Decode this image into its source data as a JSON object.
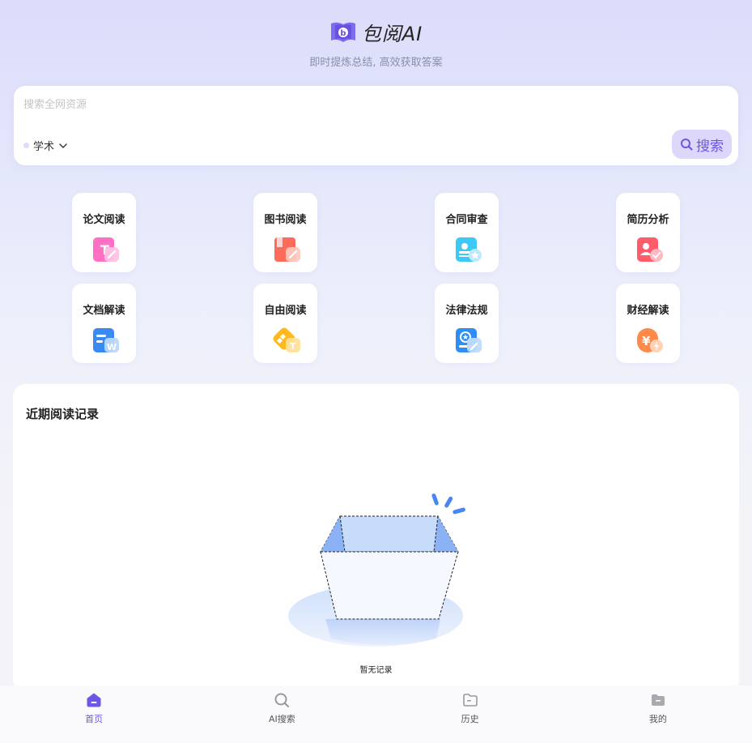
{
  "brand": {
    "name": "包阅AI",
    "tagline": "即时提炼总结, 高效获取答案"
  },
  "search": {
    "placeholder": "搜索全网资源",
    "category": "学术",
    "button_label": "搜索"
  },
  "tools": [
    {
      "label": "论文阅读",
      "icon": "paper-icon"
    },
    {
      "label": "图书阅读",
      "icon": "book-icon"
    },
    {
      "label": "合同审查",
      "icon": "contract-icon"
    },
    {
      "label": "简历分析",
      "icon": "resume-icon"
    },
    {
      "label": "文档解读",
      "icon": "document-icon"
    },
    {
      "label": "自由阅读",
      "icon": "free-read-icon"
    },
    {
      "label": "法律法规",
      "icon": "law-icon"
    },
    {
      "label": "财经解读",
      "icon": "finance-icon"
    }
  ],
  "records": {
    "title": "近期阅读记录",
    "empty_text": "暂无记录"
  },
  "tabbar": [
    {
      "label": "首页",
      "icon": "home-icon",
      "active": true
    },
    {
      "label": "AI搜索",
      "icon": "search-icon",
      "active": false
    },
    {
      "label": "历史",
      "icon": "folder-icon",
      "active": false
    },
    {
      "label": "我的",
      "icon": "profile-icon",
      "active": false
    }
  ],
  "colors": {
    "accent": "#6b56e6",
    "accent_light": "#dcd7fb"
  }
}
